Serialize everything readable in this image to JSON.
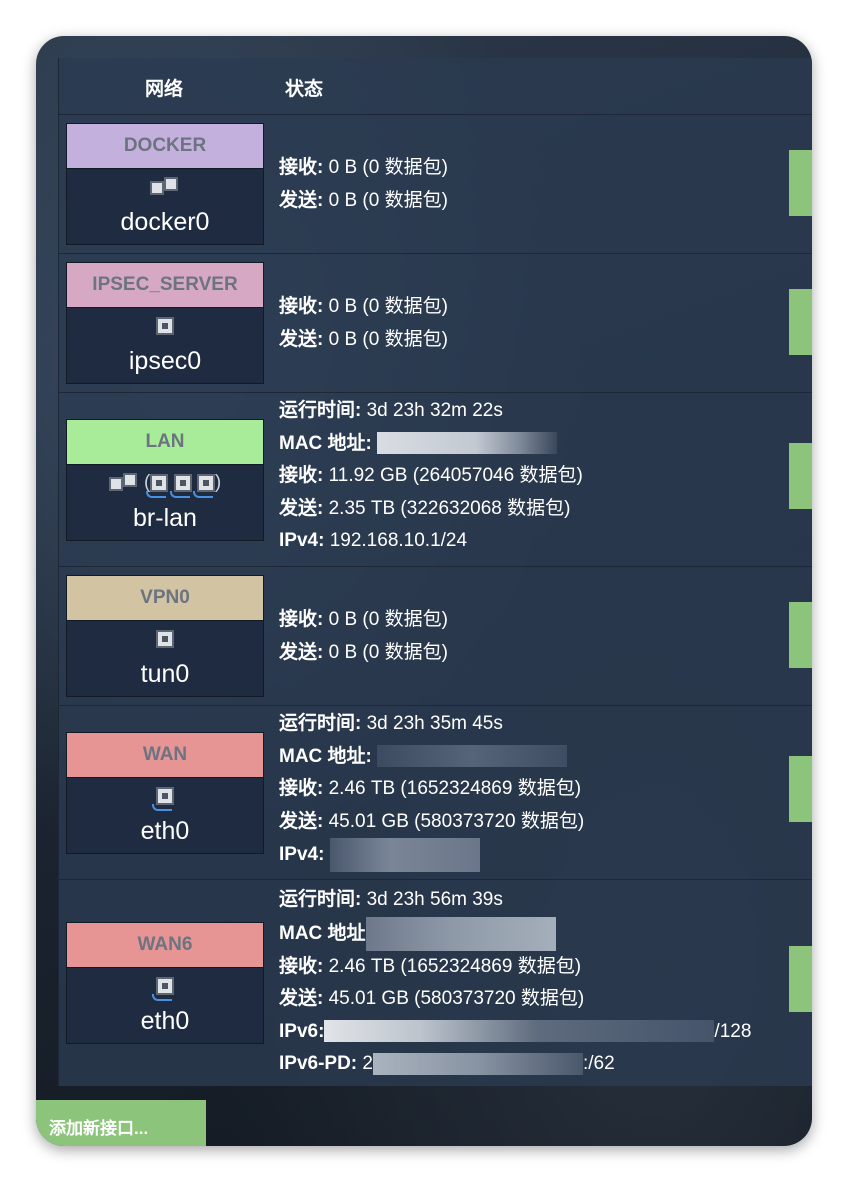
{
  "table": {
    "header": {
      "network": "网络",
      "status": "状态"
    }
  },
  "interfaces": [
    {
      "zone": "DOCKER",
      "zone_color": "#c4b0dc",
      "device": "docker0",
      "icon": "bridge-icon",
      "lines": [
        {
          "label": "接收:",
          "value": "0 B (0 数据包)"
        },
        {
          "label": "发送:",
          "value": "0 B (0 数据包)"
        }
      ]
    },
    {
      "zone": "IPSEC_SERVER",
      "zone_color": "#d7a8c4",
      "device": "ipsec0",
      "icon": "ethernet-port-icon",
      "lines": [
        {
          "label": "接收:",
          "value": "0 B (0 数据包)"
        },
        {
          "label": "发送:",
          "value": "0 B (0 数据包)"
        }
      ]
    },
    {
      "zone": "LAN",
      "zone_color": "#a8ec9a",
      "device": "br-lan",
      "icon": "bridge-with-ports-icon",
      "lines": [
        {
          "label": "运行时间:",
          "value": "3d 23h 32m 22s"
        },
        {
          "label": "MAC 地址:",
          "value": ""
        },
        {
          "label": "接收:",
          "value": "11.92 GB (264057046 数据包)"
        },
        {
          "label": "发送:",
          "value": "2.35 TB (322632068 数据包)"
        },
        {
          "label": "IPv4:",
          "value": "192.168.10.1/24"
        }
      ]
    },
    {
      "zone": "VPN0",
      "zone_color": "#d2c3a2",
      "device": "tun0",
      "icon": "ethernet-port-icon",
      "lines": [
        {
          "label": "接收:",
          "value": "0 B (0 数据包)"
        },
        {
          "label": "发送:",
          "value": "0 B (0 数据包)"
        }
      ]
    },
    {
      "zone": "WAN",
      "zone_color": "#e69494",
      "device": "eth0",
      "icon": "ethernet-plugged-icon",
      "lines": [
        {
          "label": "运行时间:",
          "value": "3d 23h 35m 45s"
        },
        {
          "label": "MAC 地址:",
          "value": ""
        },
        {
          "label": "接收:",
          "value": "2.46 TB (1652324869 数据包)"
        },
        {
          "label": "发送:",
          "value": "45.01 GB (580373720 数据包)"
        },
        {
          "label": "IPv4:",
          "value": ""
        }
      ]
    },
    {
      "zone": "WAN6",
      "zone_color": "#e69494",
      "device": "eth0",
      "icon": "ethernet-plugged-icon",
      "lines": [
        {
          "label": "运行时间:",
          "value": "3d 23h 56m 39s"
        },
        {
          "label": "MAC 地址",
          "value": ""
        },
        {
          "label": "接收:",
          "value": "2.46 TB (1652324869 数据包)"
        },
        {
          "label": "发送:",
          "value": "45.01 GB (580373720 数据包)"
        },
        {
          "label": "IPv6:",
          "value": "/128"
        },
        {
          "label": "IPv6-PD:",
          "value": "2",
          "value_suffix": ":/62"
        }
      ]
    }
  ],
  "actions": {
    "add_interface": "添加新接口..."
  },
  "colors": {
    "status_bar": "#8cc47c",
    "panel": "#2b3a50"
  }
}
